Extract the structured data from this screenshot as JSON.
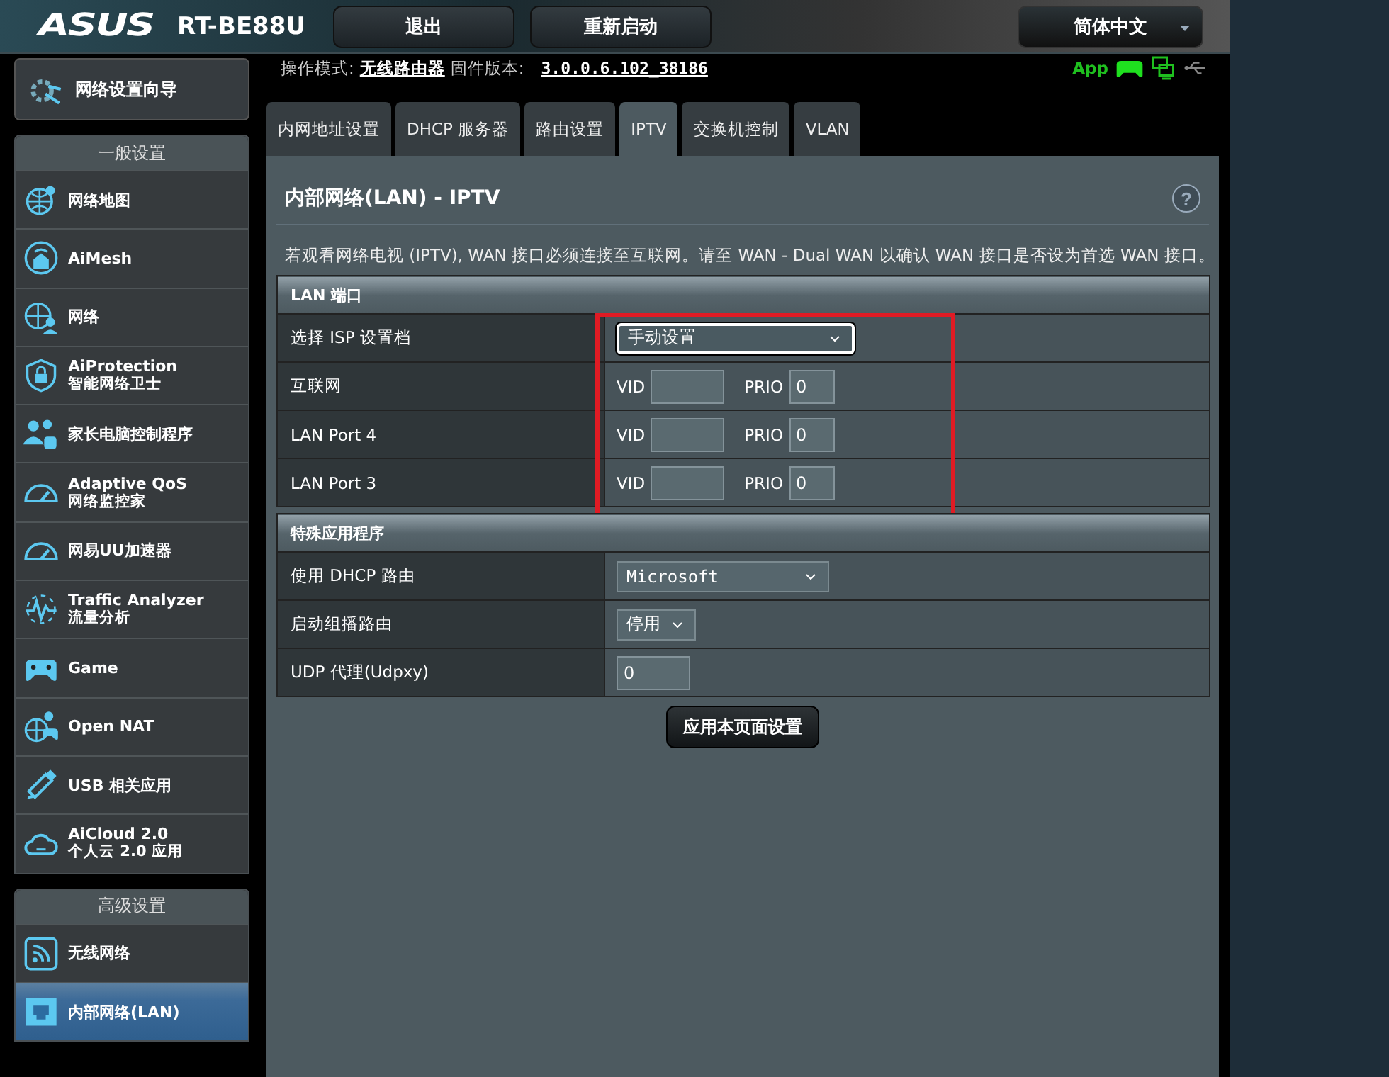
{
  "header": {
    "logo": "ASUS",
    "model": "RT-BE88U",
    "buttons": [
      "退出",
      "重新启动"
    ],
    "language": "简体中文"
  },
  "status": {
    "mode_label": "操作模式:",
    "mode": "无线路由器",
    "firmware_label": "固件版本:",
    "firmware": "3.0.0.6.102_38186",
    "app": "App"
  },
  "sidebar": {
    "wizard": "网络设置向导",
    "groups": [
      {
        "title": "一般设置",
        "items": [
          {
            "label": "网络地图",
            "selected": false
          },
          {
            "label": "AiMesh",
            "selected": false
          },
          {
            "label": "网络",
            "selected": false
          },
          {
            "label": "AiProtection",
            "sublabel": "智能网络卫士",
            "selected": false
          },
          {
            "label": "家长电脑控制程序",
            "selected": false
          },
          {
            "label": "Adaptive QoS",
            "sublabel": "网络监控家",
            "selected": false
          },
          {
            "label": "网易UU加速器",
            "selected": false
          },
          {
            "label": "Traffic Analyzer",
            "sublabel": "流量分析",
            "selected": false
          },
          {
            "label": "Game",
            "selected": false
          },
          {
            "label": "Open NAT",
            "selected": false
          },
          {
            "label": "USB 相关应用",
            "selected": false
          },
          {
            "label": "AiCloud 2.0",
            "sublabel": "个人云 2.0 应用",
            "selected": false
          }
        ]
      },
      {
        "title": "高级设置",
        "items": [
          {
            "label": "无线网络",
            "selected": false
          },
          {
            "label": "内部网络(LAN)",
            "selected": true
          }
        ]
      }
    ]
  },
  "tabs": [
    {
      "label": "内网地址设置",
      "selected": false
    },
    {
      "label": "DHCP 服务器",
      "selected": false
    },
    {
      "label": "路由设置",
      "selected": false
    },
    {
      "label": "IPTV",
      "selected": true
    },
    {
      "label": "交换机控制",
      "selected": false
    },
    {
      "label": "VLAN",
      "selected": false
    }
  ],
  "panel": {
    "title": "内部网络(LAN) - IPTV",
    "help": "?",
    "description": {
      "before": "若观看网络电视 (IPTV), WAN 接口必须连接至互联网。请至 ",
      "link": "WAN - Dual WAN",
      "after": " 以确认 WAN 接口是否设为首选 WAN 接口。"
    },
    "sections": [
      {
        "title": "LAN 端口",
        "annotation": {
          "kind": "rectangle"
        },
        "rows": [
          {
            "kind": "select",
            "label": "选择 ISP 设置档",
            "value": "手动设置",
            "focused": true
          },
          {
            "kind": "vlan",
            "label": "互联网",
            "vid_label": "VID",
            "prio_label": "PRIO",
            "prio": "0"
          },
          {
            "kind": "vlan",
            "label": "LAN Port 4",
            "vid_label": "VID",
            "prio_label": "PRIO",
            "prio": "0"
          },
          {
            "kind": "vlan",
            "label": "LAN Port 3",
            "vid_label": "VID",
            "prio_label": "PRIO",
            "prio": "0"
          }
        ]
      },
      {
        "title": "特殊应用程序",
        "rows": [
          {
            "kind": "select",
            "label": "使用 DHCP 路由",
            "value": "Microsoft",
            "focused": false,
            "mono": true
          },
          {
            "kind": "select",
            "label": "启动组播路由",
            "value": "停用",
            "focused": false
          },
          {
            "kind": "input",
            "label": "UDP 代理(Udpxy)",
            "value": "0"
          }
        ]
      }
    ],
    "apply": "应用本页面设置"
  }
}
